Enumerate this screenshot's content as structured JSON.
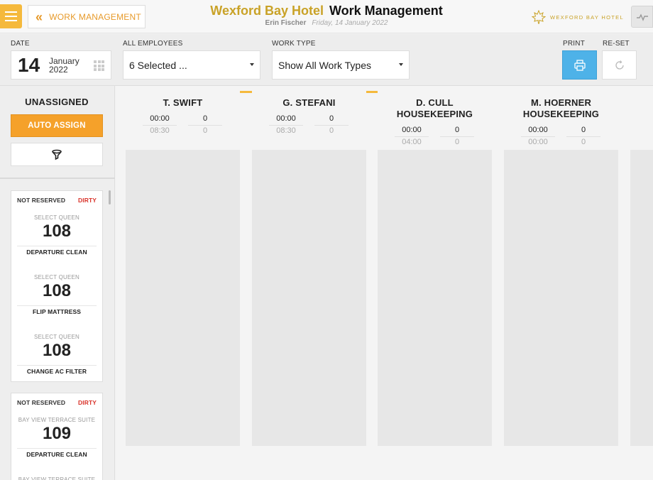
{
  "header": {
    "back_label": "WORK MANAGEMENT",
    "hotel_name": "Wexford Bay Hotel",
    "app_title": "Work Management",
    "user_name": "Erin Fischer",
    "date_text": "Friday, 14 January 2022",
    "brand_text": "WEXFORD BAY HOTEL"
  },
  "filters": {
    "date_label": "DATE",
    "date_day": "14",
    "date_month": "January",
    "date_year": "2022",
    "employees_label": "ALL EMPLOYEES",
    "employees_value": "6 Selected ...",
    "worktype_label": "WORK TYPE",
    "worktype_value": "Show All Work Types",
    "print_label": "PRINT",
    "reset_label": "RE-SET"
  },
  "left": {
    "title": "UNASSIGNED",
    "auto_assign": "AUTO ASSIGN",
    "groups": [
      {
        "status": "NOT RESERVED",
        "condition": "DIRTY",
        "rooms": [
          {
            "type": "SELECT QUEEN",
            "number": "108",
            "task": "DEPARTURE CLEAN"
          },
          {
            "type": "SELECT QUEEN",
            "number": "108",
            "task": "FLIP MATTRESS"
          },
          {
            "type": "SELECT QUEEN",
            "number": "108",
            "task": "CHANGE AC FILTER"
          }
        ]
      },
      {
        "status": "NOT RESERVED",
        "condition": "DIRTY",
        "rooms": [
          {
            "type": "BAY VIEW TERRACE SUITE",
            "number": "109",
            "task": "DEPARTURE CLEAN"
          },
          {
            "type": "BAY VIEW TERRACE SUITE",
            "number": "",
            "task": ""
          }
        ]
      }
    ]
  },
  "columns": [
    {
      "name": "T. SWIFT",
      "name2": "",
      "time_assigned": "00:00",
      "count_assigned": "0",
      "time_total": "08:30",
      "count_total": "0"
    },
    {
      "name": "G. STEFANI",
      "name2": "",
      "time_assigned": "00:00",
      "count_assigned": "0",
      "time_total": "08:30",
      "count_total": "0"
    },
    {
      "name": "D. CULL",
      "name2": "HOUSEKEEPING",
      "time_assigned": "00:00",
      "count_assigned": "0",
      "time_total": "04:00",
      "count_total": "0"
    },
    {
      "name": "M. HOERNER",
      "name2": "HOUSEKEEPING",
      "time_assigned": "00:00",
      "count_assigned": "0",
      "time_total": "00:00",
      "count_total": "0"
    }
  ],
  "colors": {
    "accent": "#f5b93c",
    "auto_assign": "#f5a12a",
    "hotel_gold": "#c9a227",
    "print_blue": "#4eb2e8",
    "dirty_red": "#d9332a"
  }
}
